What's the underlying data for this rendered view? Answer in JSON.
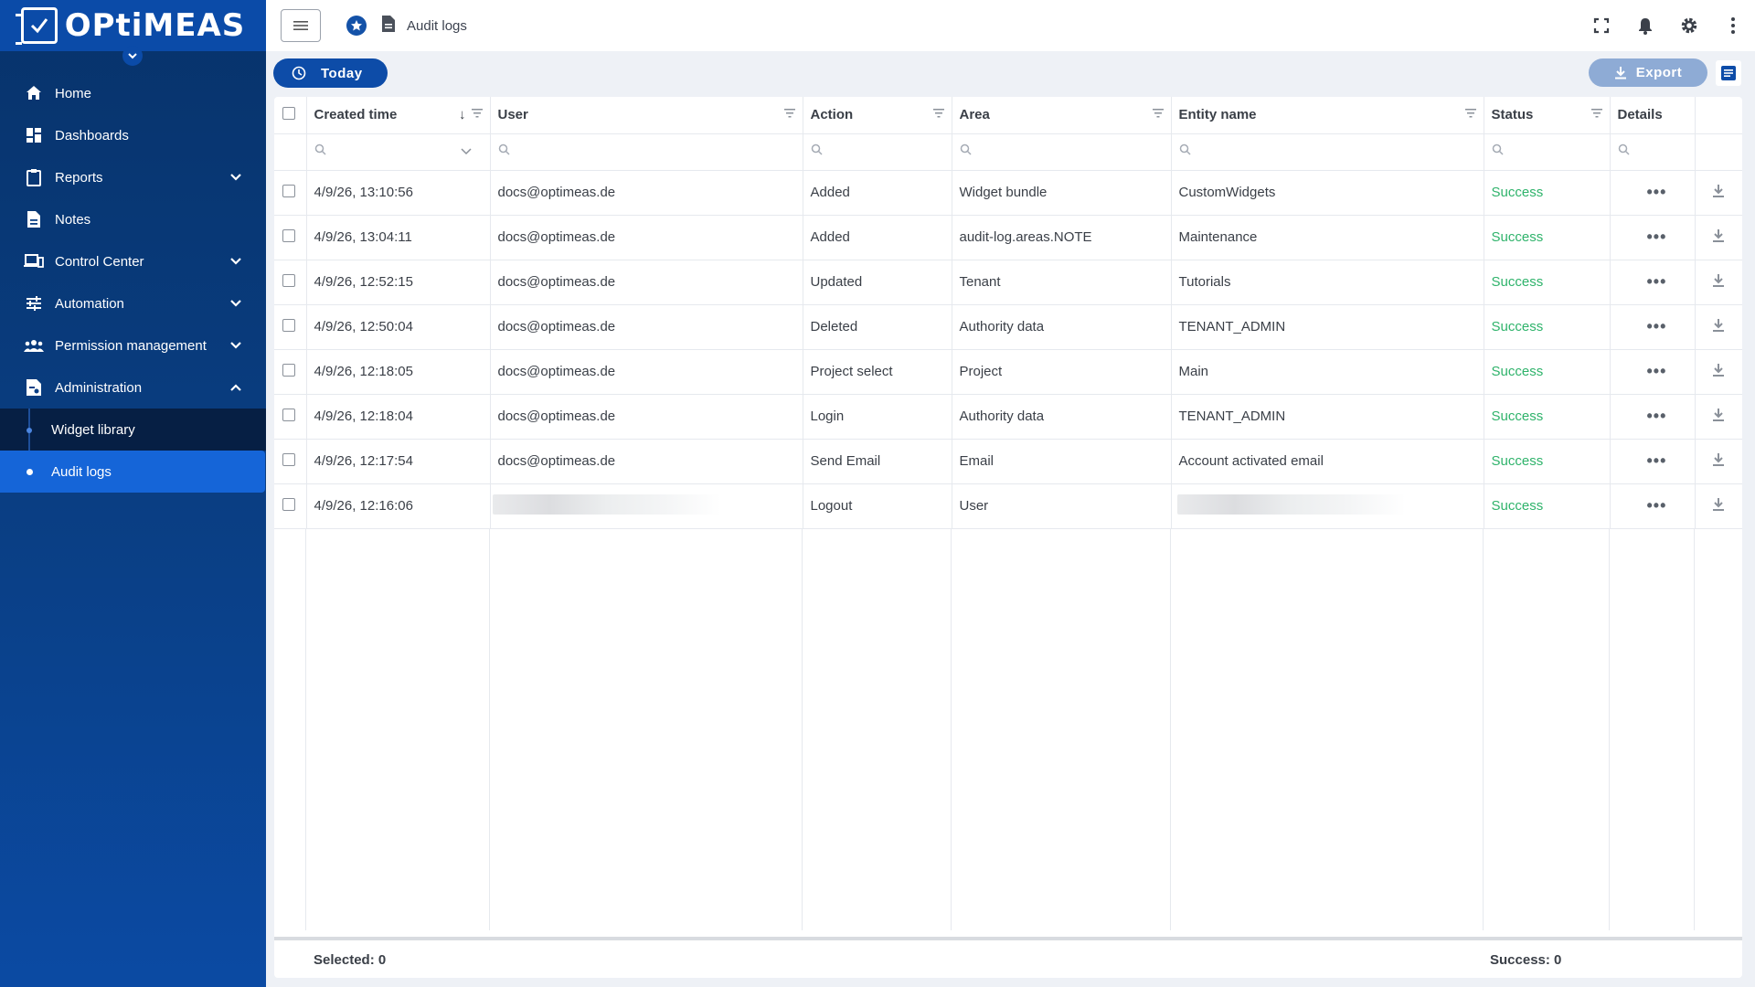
{
  "brand": {
    "name": "OPtiMEAS"
  },
  "nav": {
    "items": [
      {
        "label": "Home",
        "icon": "home-icon"
      },
      {
        "label": "Dashboards",
        "icon": "dashboard-icon"
      },
      {
        "label": "Reports",
        "icon": "clipboard-icon",
        "expandable": true
      },
      {
        "label": "Notes",
        "icon": "note-icon"
      },
      {
        "label": "Control Center",
        "icon": "devices-icon",
        "expandable": true
      },
      {
        "label": "Automation",
        "icon": "tune-icon",
        "expandable": true
      },
      {
        "label": "Permission management",
        "icon": "people-icon",
        "expandable": true
      },
      {
        "label": "Administration",
        "icon": "admin-doc-icon",
        "expanded": true
      }
    ],
    "sub_items": [
      "Widget library"
    ],
    "active": "Audit logs"
  },
  "topbar": {
    "breadcrumb": "Audit logs"
  },
  "toolbar": {
    "today_label": "Today",
    "export_label": "Export"
  },
  "table": {
    "columns": [
      "Created time",
      "User",
      "Action",
      "Area",
      "Entity name",
      "Status",
      "Details"
    ],
    "rows": [
      {
        "time": "4/9/26, 13:10:56",
        "user": "docs@optimeas.de",
        "action": "Added",
        "area": "Widget bundle",
        "entity": "CustomWidgets",
        "status": "Success"
      },
      {
        "time": "4/9/26, 13:04:11",
        "user": "docs@optimeas.de",
        "action": "Added",
        "area": "audit-log.areas.NOTE",
        "entity": "Maintenance",
        "status": "Success"
      },
      {
        "time": "4/9/26, 12:52:15",
        "user": "docs@optimeas.de",
        "action": "Updated",
        "area": "Tenant",
        "entity": "Tutorials",
        "status": "Success"
      },
      {
        "time": "4/9/26, 12:50:04",
        "user": "docs@optimeas.de",
        "action": "Deleted",
        "area": "Authority data",
        "entity": "TENANT_ADMIN",
        "status": "Success"
      },
      {
        "time": "4/9/26, 12:18:05",
        "user": "docs@optimeas.de",
        "action": "Project select",
        "area": "Project",
        "entity": "Main",
        "status": "Success"
      },
      {
        "time": "4/9/26, 12:18:04",
        "user": "docs@optimeas.de",
        "action": "Login",
        "area": "Authority data",
        "entity": "TENANT_ADMIN",
        "status": "Success"
      },
      {
        "time": "4/9/26, 12:17:54",
        "user": "docs@optimeas.de",
        "action": "Send Email",
        "area": "Email",
        "entity": "Account activated email",
        "status": "Success"
      },
      {
        "time": "4/9/26, 12:16:06",
        "user": "",
        "action": "Logout",
        "area": "User",
        "entity": "",
        "status": "Success"
      }
    ]
  },
  "footer": {
    "selected": "Selected: 0",
    "success": "Success: 0"
  },
  "colors": {
    "sidebar": "#0a3f85",
    "active": "#1565d8",
    "accent": "#0d4ca8",
    "success": "#2fb36b"
  }
}
